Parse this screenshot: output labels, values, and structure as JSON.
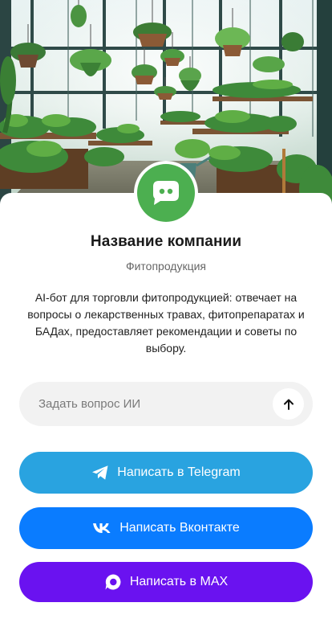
{
  "company": {
    "name": "Название компании",
    "category": "Фитопродукция",
    "description": "AI-бот для торговли фитопродукцией: отвечает на вопросы о лекарственных травах, фитопрепаратах и БАДах, предоставляет рекомендации и советы по выбору."
  },
  "avatar": {
    "icon": "chat-bot-icon",
    "color": "#4caf50"
  },
  "hero": {
    "icon": "greenhouse-illustration"
  },
  "ask": {
    "placeholder": "Задать вопрос ИИ",
    "send_icon": "arrow-up-icon"
  },
  "actions": {
    "telegram": {
      "label": "Написать в Telegram",
      "icon": "telegram-icon",
      "color": "#29a3e0"
    },
    "vk": {
      "label": "Написать Вконтакте",
      "icon": "vk-icon",
      "color": "#0a7cff"
    },
    "max": {
      "label": "Написать в MAX",
      "icon": "max-icon",
      "color": "#6a12f0"
    }
  }
}
